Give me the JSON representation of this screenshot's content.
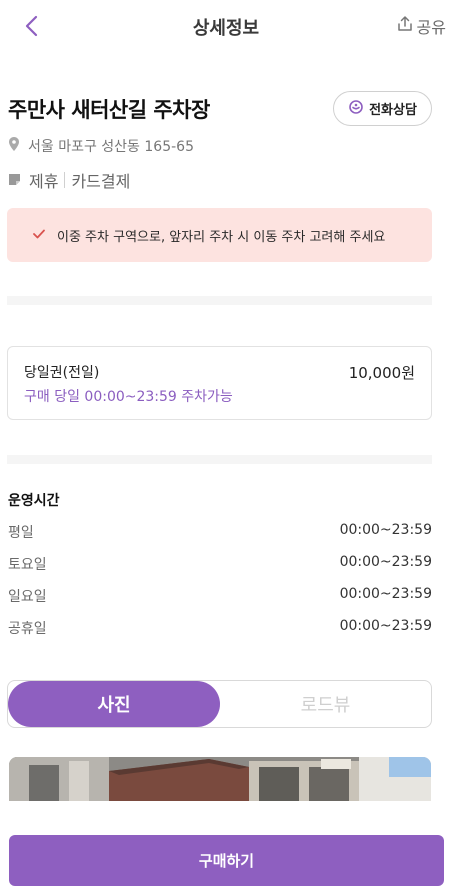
{
  "header": {
    "title": "상세정보",
    "share_label": "공유"
  },
  "lot": {
    "name": "주만사 새터산길 주차장",
    "call_label": "전화상담",
    "address": "서울 마포구 성산동 165-65",
    "tags": [
      "제휴",
      "카드결제"
    ]
  },
  "alert": {
    "text": "이중 주차 구역으로, 앞자리 주차 시 이동 주차 고려해 주세요"
  },
  "ticket": {
    "name": "당일권(전일)",
    "price": "10,000원",
    "hours": "구매 당일 00:00~23:59 주차가능"
  },
  "hours": {
    "title": "운영시간",
    "rows": [
      {
        "day": "평일",
        "time": "00:00~23:59"
      },
      {
        "day": "토요일",
        "time": "00:00~23:59"
      },
      {
        "day": "일요일",
        "time": "00:00~23:59"
      },
      {
        "day": "공휴일",
        "time": "00:00~23:59"
      }
    ]
  },
  "tabs": {
    "photo": "사진",
    "roadview": "로드뷰"
  },
  "buy_label": "구매하기",
  "colors": {
    "accent": "#8e5fc0",
    "alert_bg": "#fde3e0",
    "alert_check": "#d9534f"
  }
}
